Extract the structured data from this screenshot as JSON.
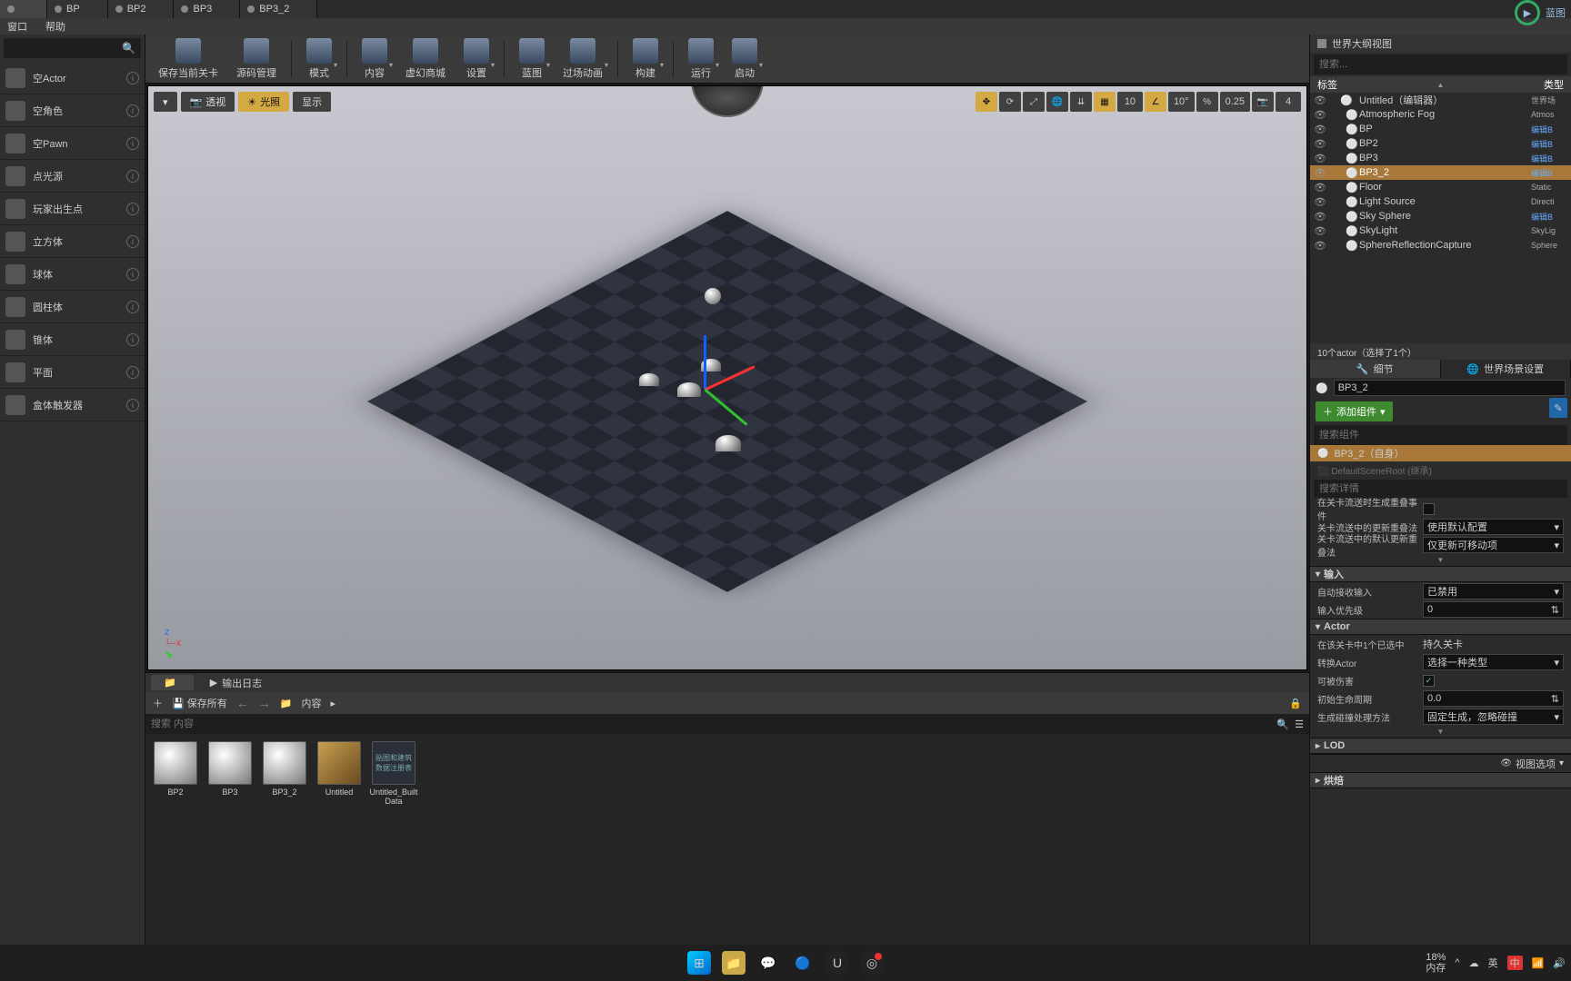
{
  "tabs": [
    "",
    "BP",
    "BP2",
    "BP3",
    "BP3_2"
  ],
  "activeTab": 0,
  "cpu_label": "蓝图",
  "menubar": [
    "窗口",
    "帮助"
  ],
  "palette_search_placeholder": "",
  "palette": [
    "空Actor",
    "空角色",
    "空Pawn",
    "点光源",
    "玩家出生点",
    "立方体",
    "球体",
    "圆柱体",
    "锥体",
    "平面",
    "盒体触发器"
  ],
  "toolbar": [
    {
      "label": "保存当前关卡",
      "drop": false
    },
    {
      "label": "源码管理",
      "drop": false
    },
    {
      "sep": true
    },
    {
      "label": "模式",
      "drop": true
    },
    {
      "sep": true
    },
    {
      "label": "内容",
      "drop": true
    },
    {
      "label": "虚幻商城",
      "drop": false
    },
    {
      "label": "设置",
      "drop": true
    },
    {
      "sep": true
    },
    {
      "label": "蓝图",
      "drop": true
    },
    {
      "label": "过场动画",
      "drop": true
    },
    {
      "sep": true
    },
    {
      "label": "构建",
      "drop": true
    },
    {
      "sep": true
    },
    {
      "label": "运行",
      "drop": true
    },
    {
      "label": "启动",
      "drop": true
    }
  ],
  "viewport": {
    "left_btns": [
      {
        "t": "▾",
        "on": false
      },
      {
        "t": "透视",
        "on": false
      },
      {
        "t": "光照",
        "on": true
      },
      {
        "t": "显示",
        "on": false
      }
    ],
    "snap_grid": "10",
    "snap_angle": "10°",
    "snap_scale": "0.25",
    "cam_speed": "4"
  },
  "cb": {
    "tab1": "",
    "tab2": "输出日志",
    "save_all": "保存所有",
    "path": "内容",
    "search_placeholder": "搜索 内容",
    "assets": [
      {
        "name": "BP2",
        "kind": "sphere"
      },
      {
        "name": "BP3",
        "kind": "sphere"
      },
      {
        "name": "BP3_2",
        "kind": "sphere"
      },
      {
        "name": "Untitled",
        "kind": "cube"
      },
      {
        "name": "Untitled_Built Data",
        "kind": "data"
      }
    ],
    "builtdata_thumb_text": "贴图和建筑数据注册表"
  },
  "outliner": {
    "title": "世界大纲视图",
    "search_placeholder": "搜索...",
    "col_label": "标签",
    "col_type": "类型",
    "rows": [
      {
        "n": "Untitled（编辑器）",
        "t": "世界场",
        "ind": 0,
        "link": false,
        "gray": true,
        "ic": "world"
      },
      {
        "n": "Atmospheric Fog",
        "t": "Atmos",
        "ind": 1,
        "link": false,
        "gray": true,
        "ic": "fog"
      },
      {
        "n": "BP",
        "t": "编辑B",
        "ind": 1,
        "link": true,
        "ic": "bp"
      },
      {
        "n": "BP2",
        "t": "编辑B",
        "ind": 1,
        "link": true,
        "ic": "bp"
      },
      {
        "n": "BP3",
        "t": "编辑B",
        "ind": 1,
        "link": true,
        "ic": "bp"
      },
      {
        "n": "BP3_2",
        "t": "编辑B",
        "ind": 1,
        "link": true,
        "sel": true,
        "ic": "bp"
      },
      {
        "n": "Floor",
        "t": "Static",
        "ind": 1,
        "link": false,
        "gray": true,
        "ic": "mesh"
      },
      {
        "n": "Light Source",
        "t": "Directi",
        "ind": 1,
        "link": false,
        "gray": true,
        "ic": "light"
      },
      {
        "n": "Sky Sphere",
        "t": "编辑B",
        "ind": 1,
        "link": true,
        "ic": "bp"
      },
      {
        "n": "SkyLight",
        "t": "SkyLig",
        "ind": 1,
        "link": false,
        "gray": true,
        "ic": "light"
      },
      {
        "n": "SphereReflectionCapture",
        "t": "Sphere",
        "ind": 1,
        "link": false,
        "gray": true,
        "ic": "refl"
      }
    ],
    "footer": "10个actor（选择了1个）"
  },
  "details": {
    "tab1": "细节",
    "tab2": "世界场景设置",
    "name_value": "BP3_2",
    "add_component": "添加组件",
    "search_comp_placeholder": "搜索组件",
    "comp_self": "BP3_2（自身）",
    "search_detail_placeholder": "搜索详情",
    "props_stream": [
      {
        "l": "在关卡流送时生成重叠事件",
        "k": "chk",
        "v": false
      },
      {
        "l": "关卡流送中的更新重叠法",
        "k": "combo",
        "v": "使用默认配置"
      },
      {
        "l": "关卡流送中的默认更新重叠法",
        "k": "combo",
        "v": "仅更新可移动项"
      }
    ],
    "sect_input": "输入",
    "props_input": [
      {
        "l": "自动接收输入",
        "k": "combo",
        "v": "已禁用"
      },
      {
        "l": "输入优先级",
        "k": "spin",
        "v": "0"
      }
    ],
    "sect_actor": "Actor",
    "props_actor": [
      {
        "l": "在该关卡中1个已选中",
        "k": "text",
        "v": "持久关卡"
      },
      {
        "l": "转换Actor",
        "k": "combo",
        "v": "选择一种类型"
      },
      {
        "l": "可被伤害",
        "k": "chk",
        "v": true
      },
      {
        "l": "初始生命周期",
        "k": "spin",
        "v": "0.0"
      },
      {
        "l": "生成碰撞处理方法",
        "k": "combo",
        "v": "固定生成，忽略碰撞"
      }
    ],
    "sect_lod": "LOD",
    "sect_bake": "烘焙",
    "view_options": "视图选项"
  },
  "taskbar": {
    "percent": "18%",
    "mem": "内存",
    "ime": "英",
    "ime2": "中"
  }
}
